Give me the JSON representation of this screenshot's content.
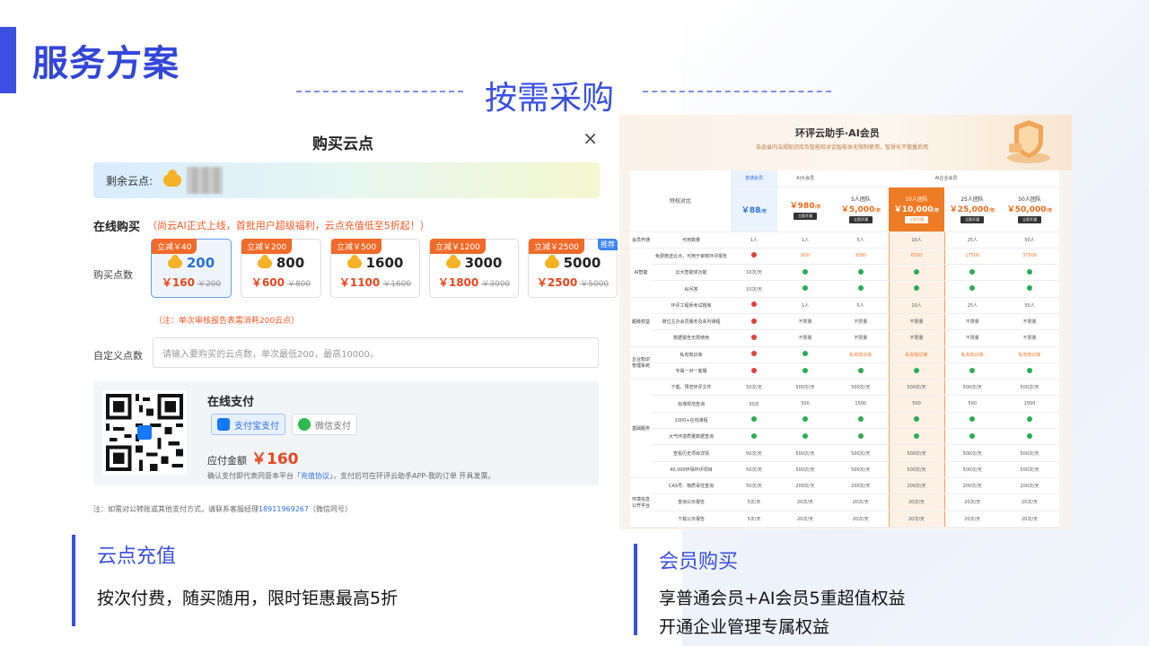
{
  "page": {
    "title": "服务方案",
    "center_title": "按需采购"
  },
  "dialog": {
    "title": "购买云点",
    "close_icon": "×",
    "balance_label": "剩余云点:",
    "online_label": "在线购买",
    "online_note": "（尚云AI正式上线，首批用户超级福利，云点充值低至5折起！）",
    "buy_label": "购买点数",
    "packs": [
      {
        "tag": "立减￥40",
        "amount": "200",
        "price": "￥160",
        "old": "￥200",
        "selected": true,
        "recommend": ""
      },
      {
        "tag": "立减￥200",
        "amount": "800",
        "price": "￥600",
        "old": "￥800",
        "selected": false,
        "recommend": ""
      },
      {
        "tag": "立减￥500",
        "amount": "1600",
        "price": "￥1100",
        "old": "￥1600",
        "selected": false,
        "recommend": ""
      },
      {
        "tag": "立减￥1200",
        "amount": "3000",
        "price": "￥1800",
        "old": "￥3000",
        "selected": false,
        "recommend": ""
      },
      {
        "tag": "立减￥2500",
        "amount": "5000",
        "price": "￥2500",
        "old": "￥5000",
        "selected": false,
        "recommend": "推荐"
      }
    ],
    "pack_note": "（注：单次审核报告表需消耗200云点）",
    "custom_label": "自定义点数",
    "custom_placeholder": "请输入要购买的云点数，单次最低200，最高10000。",
    "pay": {
      "title": "在线支付",
      "alipay": "支付宝支付",
      "wechat": "微信支付",
      "due_label": "应付金额",
      "due_value": "￥160",
      "note_prefix": "确认支付即代表同意本平台",
      "note_link": "「充值协议」",
      "note_suffix": "，支付后可在环评云助手APP-我的订单 开具发票。"
    },
    "footer_prefix": "注：如需对公转账或其他支付方式，请联系客服经理",
    "footer_phone": "18911969267",
    "footer_suffix": "（微信同号）"
  },
  "member": {
    "title": "环评云助手·AI会员",
    "subtitle": "自选省内法规知识库及智能较对话智能体无限制使用，智慧化不做量后用",
    "feature_header": "特权对比",
    "col_normal": "普通会员",
    "col_ai": "AI大会员",
    "col_enterprise": "AI企业会员",
    "plans": [
      {
        "name": "",
        "price": "￥88",
        "unit": "/年",
        "btn": ""
      },
      {
        "name": "",
        "price": "￥980",
        "unit": "/年",
        "btn": "立即开通"
      },
      {
        "name": "5人团队",
        "price": "￥5,000",
        "unit": "/年",
        "btn": "立即开通"
      },
      {
        "name": "10人团队",
        "price": "￥10,000",
        "unit": "/年",
        "btn": "立即开通"
      },
      {
        "name": "25人团队",
        "price": "￥25,000",
        "unit": "/年",
        "btn": "立即开通"
      },
      {
        "name": "50人团队",
        "price": "￥50,000",
        "unit": "/年",
        "btn": "立即开通"
      }
    ],
    "rows": [
      {
        "group": "会员开通",
        "feature": "可用数量",
        "cells": [
          "1人",
          "1人",
          "5人",
          "10人",
          "25人",
          "50人"
        ]
      },
      {
        "group": "AI智能",
        "feature": "免费赠送云点，可用于审核环评报告",
        "cells": [
          "x",
          "600",
          "3000",
          "6500",
          "17500",
          "37500"
        ]
      },
      {
        "group": "",
        "feature": "云大智能体功能",
        "cells": [
          "10次/天",
          "ok",
          "ok",
          "ok",
          "ok",
          "ok"
        ]
      },
      {
        "group": "",
        "feature": "AI问答",
        "cells": [
          "10次/天",
          "ok",
          "ok",
          "ok",
          "ok",
          "ok"
        ]
      },
      {
        "group": "超级权益",
        "feature": "环评工程师考试题库",
        "cells": [
          "x",
          "1人",
          "5人",
          "10人",
          "25人",
          "50人"
        ]
      },
      {
        "group": "",
        "feature": "岗位主办会员服务及系列课程",
        "cells": [
          "x",
          "不限量",
          "不限量",
          "不限量",
          "不限量",
          "不限量"
        ]
      },
      {
        "group": "",
        "feature": "数据报告无限使用",
        "cells": [
          "x",
          "不限量",
          "不限量",
          "不限量",
          "不限量",
          "不限量"
        ]
      },
      {
        "group": "企业知识管理系统",
        "feature": "私有知识库",
        "cells": [
          "x",
          "ok",
          "私有知识库",
          "私有知识库",
          "私有知识库",
          "私有知识库"
        ]
      },
      {
        "group": "",
        "feature": "专属一对一客服",
        "cells": [
          "x",
          "ok",
          "ok",
          "ok",
          "ok",
          "ok"
        ]
      },
      {
        "group": "基础服务",
        "feature": "下载、预览环评文件",
        "cells": [
          "50次/天",
          "500次/天",
          "500次/天",
          "500次/天",
          "500次/天",
          "500次/天"
        ]
      },
      {
        "group": "",
        "feature": "标准规范查询",
        "cells": [
          "50次",
          "500",
          "1500",
          "500",
          "500",
          "1500"
        ]
      },
      {
        "group": "",
        "feature": "1000+在线课程",
        "cells": [
          "ok",
          "ok",
          "ok",
          "ok",
          "ok",
          "ok"
        ]
      },
      {
        "group": "",
        "feature": "大气环境质量数据查询",
        "cells": [
          "ok",
          "ok",
          "ok",
          "ok",
          "ok",
          "ok"
        ]
      },
      {
        "group": "",
        "feature": "查看历史项目详情",
        "cells": [
          "50次/天",
          "500次/天",
          "500次/天",
          "500次/天",
          "500次/天",
          "500次/天"
        ]
      },
      {
        "group": "",
        "feature": "40,000环保环评项目",
        "cells": [
          "50次/天",
          "500次/天",
          "500次/天",
          "500次/天",
          "500次/天",
          "500次/天"
        ]
      },
      {
        "group": "环境信息公开平台",
        "feature": "CAS号、物质毒性查询",
        "cells": [
          "50次/天",
          "200次/天",
          "200次/天",
          "200次/天",
          "200次/天",
          "200次/天"
        ]
      },
      {
        "group": "",
        "feature": "查询公示报告",
        "cells": [
          "5次/天",
          "20次/天",
          "20次/天",
          "20次/天",
          "20次/天",
          "20次/天"
        ]
      },
      {
        "group": "",
        "feature": "下载公示报告",
        "cells": [
          "5次/天",
          "20次/天",
          "20次/天",
          "20次/天",
          "20次/天",
          "20次/天"
        ]
      }
    ]
  },
  "captions": {
    "left_title": "云点充值",
    "left_text": "按次付费，随买随用，限时钜惠最高5折",
    "right_title": "会员购买",
    "right_text_1": "享普通会员+AI会员5重超值权益",
    "right_text_2": "开通企业管理专属权益"
  },
  "colors": {
    "accent": "#3b4fe0",
    "price_red": "#e8451f",
    "highlight_orange": "#ee7b25",
    "ok_green": "#2eaa55",
    "no_red": "#e24040"
  }
}
